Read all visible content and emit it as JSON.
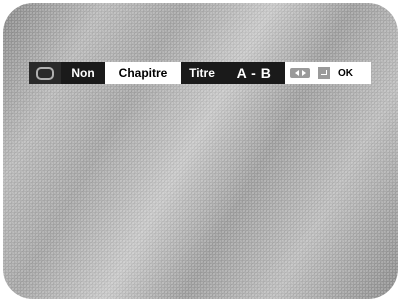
{
  "menu": {
    "options": [
      "Non",
      "Chapitre",
      "Titre",
      "A - B"
    ],
    "selected": "Chapitre"
  },
  "hint": {
    "ok_label": "OK"
  },
  "icons": {
    "repeat": "repeat-icon",
    "left_right": "left-right-arrows-icon",
    "enter": "enter-icon"
  }
}
